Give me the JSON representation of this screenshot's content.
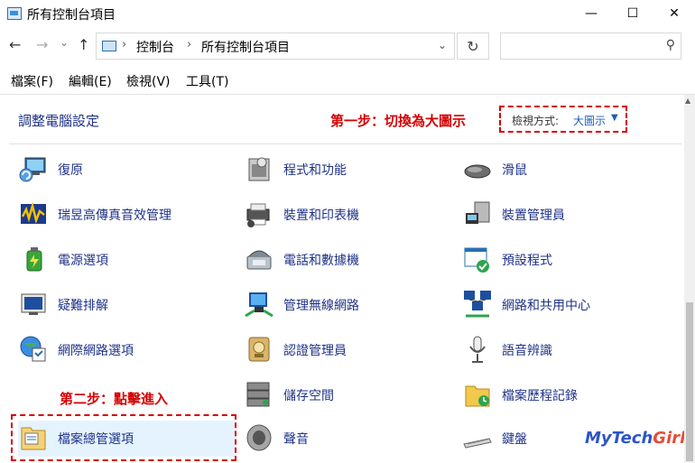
{
  "window": {
    "title": "所有控制台項目",
    "min": "—",
    "max": "☐",
    "close": "✕"
  },
  "nav": {
    "back": "←",
    "forward": "→",
    "history": "⌄",
    "up": "↑"
  },
  "address": {
    "crumbs": [
      "控制台",
      "所有控制台項目"
    ],
    "sep": "›",
    "dropdown": "⌄",
    "refresh": "↻"
  },
  "search": {
    "placeholder": "",
    "icon": "⚲"
  },
  "menu": [
    "檔案(F)",
    "編輯(E)",
    "檢視(V)",
    "工具(T)"
  ],
  "heading": "調整電腦設定",
  "annotations": {
    "step1": "第一步：切換為大圖示",
    "step2": "第二步：點擊進入"
  },
  "view": {
    "label": "檢視方式:",
    "value": "大圖示",
    "caret": "▼"
  },
  "items": [
    [
      "復原",
      "程式和功能",
      "滑鼠"
    ],
    [
      "瑞昱高傳真音效管理",
      "裝置和印表機",
      "裝置管理員"
    ],
    [
      "電源選項",
      "電話和數據機",
      "預設程式"
    ],
    [
      "疑難排解",
      "管理無線網路",
      "網路和共用中心"
    ],
    [
      "網際網路選項",
      "認證管理員",
      "語音辨識"
    ],
    [
      "",
      "儲存空間",
      "檔案歷程記錄"
    ],
    [
      "檔案總管選項",
      "聲音",
      "鍵盤"
    ]
  ],
  "watermark": {
    "part1": "MyTech",
    "part2": "Girl"
  },
  "colors": {
    "link": "#1e3287",
    "annotation": "#d40000",
    "accent": "#1a5fb4",
    "highlight": "#e5f3ff"
  }
}
